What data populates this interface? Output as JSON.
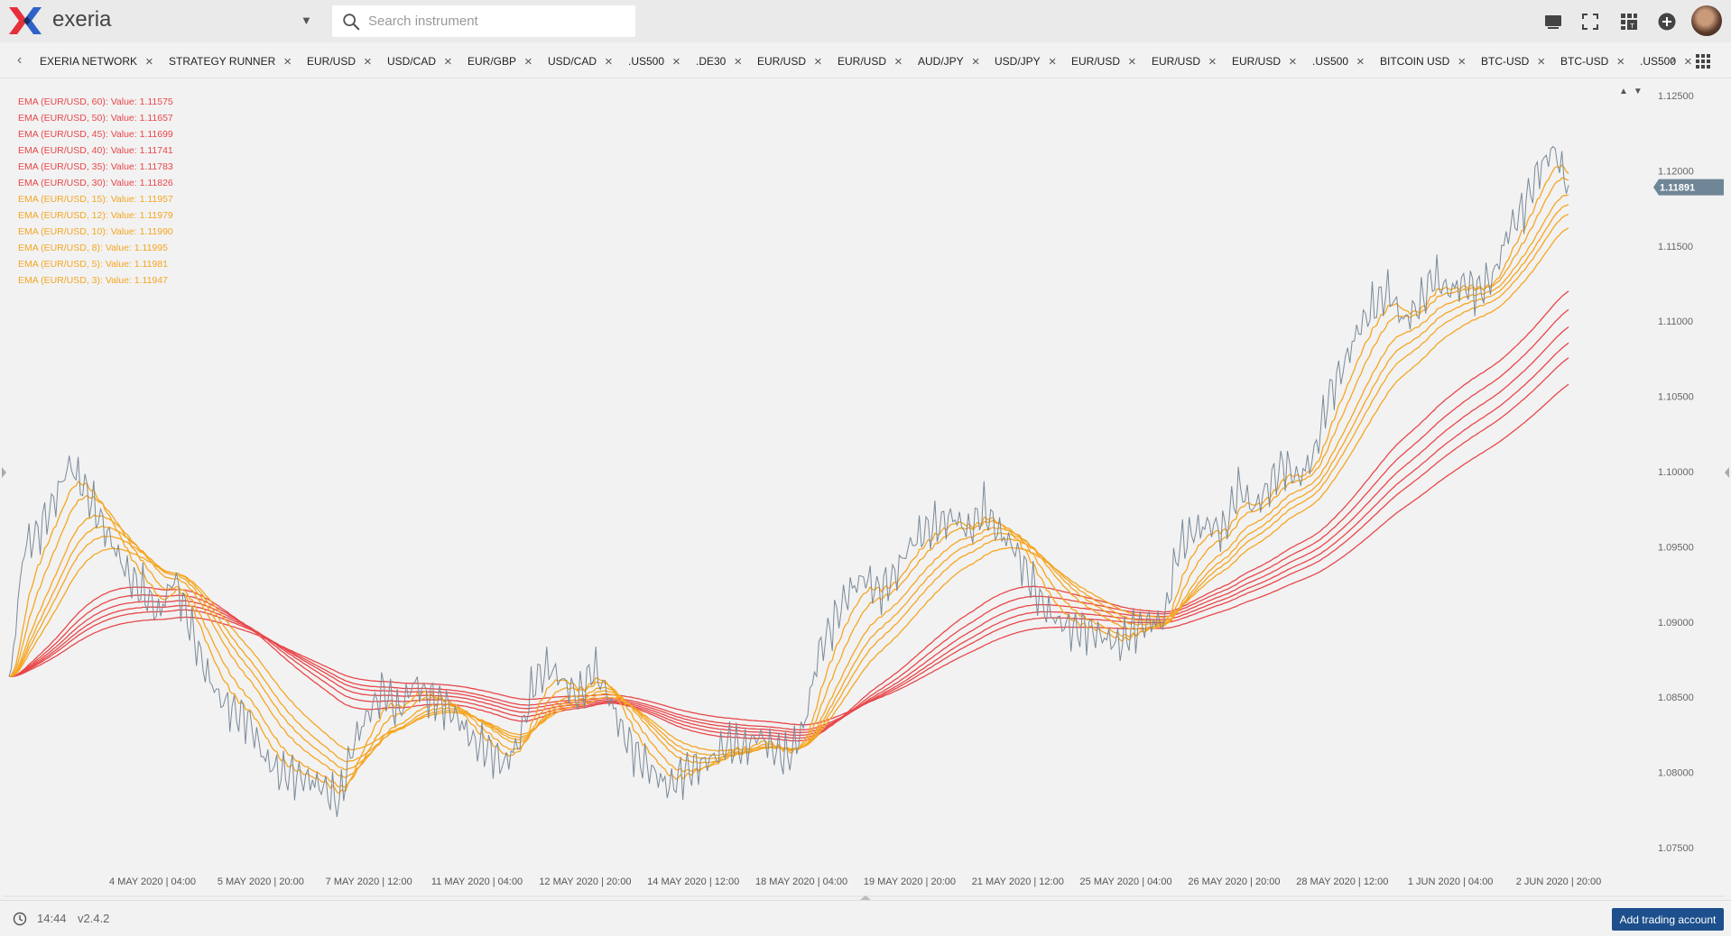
{
  "app": {
    "name": "exeria",
    "logo_colors": {
      "red": "#e5303a",
      "blue": "#2f62c8",
      "dark": "#1a2f66"
    }
  },
  "search": {
    "placeholder": "Search instrument",
    "value": ""
  },
  "header_icons": [
    "monitor-icon",
    "fullscreen-icon",
    "layout-icon",
    "add-circle-icon"
  ],
  "tabs": [
    {
      "label": "EXERIA NETWORK"
    },
    {
      "label": "STRATEGY RUNNER"
    },
    {
      "label": "EUR/USD"
    },
    {
      "label": "USD/CAD"
    },
    {
      "label": "EUR/GBP"
    },
    {
      "label": "USD/CAD"
    },
    {
      "label": ".US500"
    },
    {
      "label": ".DE30"
    },
    {
      "label": "EUR/USD"
    },
    {
      "label": "EUR/USD"
    },
    {
      "label": "AUD/JPY"
    },
    {
      "label": "USD/JPY"
    },
    {
      "label": "EUR/USD"
    },
    {
      "label": "EUR/USD"
    },
    {
      "label": "EUR/USD"
    },
    {
      "label": ".US500"
    },
    {
      "label": "BITCOIN USD"
    },
    {
      "label": "BTC-USD"
    },
    {
      "label": "BTC-USD"
    },
    {
      "label": ".US500"
    }
  ],
  "chart_data": {
    "type": "line",
    "legend_placement": "top-left",
    "grid": false,
    "ylim": [
      1.075,
      1.125
    ],
    "y_ticks": [
      "1.12500",
      "1.12000",
      "1.11500",
      "1.11000",
      "1.10500",
      "1.10000",
      "1.09500",
      "1.09000",
      "1.08500",
      "1.08000",
      "1.07500"
    ],
    "x_ticks": [
      "4 MAY 2020 | 04:00",
      "5 MAY 2020 | 20:00",
      "7 MAY 2020 | 12:00",
      "11 MAY 2020 | 04:00",
      "12 MAY 2020 | 20:00",
      "14 MAY 2020 | 12:00",
      "18 MAY 2020 | 04:00",
      "19 MAY 2020 | 20:00",
      "21 MAY 2020 | 12:00",
      "25 MAY 2020 | 04:00",
      "26 MAY 2020 | 20:00",
      "28 MAY 2020 | 12:00",
      "1 JUN 2020 | 04:00",
      "2 JUN 2020 | 20:00"
    ],
    "current_price": "1.11891",
    "price_series": {
      "color": "#7a8a99",
      "values": [
        1.0855,
        1.095,
        1.096,
        1.098,
        1.1005,
        1.099,
        1.097,
        1.095,
        1.093,
        1.092,
        1.0905,
        1.093,
        1.09,
        1.087,
        1.085,
        1.084,
        1.0835,
        1.081,
        1.08,
        1.0798,
        1.0795,
        1.079,
        1.078,
        1.082,
        1.084,
        1.0855,
        1.084,
        1.086,
        1.085,
        1.0845,
        1.0835,
        1.082,
        1.0815,
        1.0805,
        1.082,
        1.086,
        1.087,
        1.086,
        1.085,
        1.087,
        1.085,
        1.0825,
        1.081,
        1.08,
        1.079,
        1.08,
        1.0805,
        1.081,
        1.082,
        1.0815,
        1.0825,
        1.0815,
        1.081,
        1.083,
        1.088,
        1.09,
        1.092,
        1.093,
        1.092,
        1.093,
        1.095,
        1.096,
        1.0965,
        1.097,
        1.096,
        1.0975,
        1.096,
        1.095,
        1.093,
        1.091,
        1.09,
        1.0895,
        1.0895,
        1.089,
        1.0885,
        1.0895,
        1.09,
        1.09,
        1.095,
        1.096,
        1.0965,
        1.096,
        1.099,
        1.0975,
        1.099,
        1.1005,
        1.0995,
        1.101,
        1.105,
        1.107,
        1.1095,
        1.111,
        1.112,
        1.11,
        1.111,
        1.113,
        1.112,
        1.1125,
        1.112,
        1.113,
        1.116,
        1.1175,
        1.12,
        1.1215,
        1.1189
      ]
    },
    "series": [
      {
        "name": "EMA (EUR/USD, 60): Value: 1.11575",
        "color": "#e8474a",
        "period": 60
      },
      {
        "name": "EMA (EUR/USD, 50): Value: 1.11657",
        "color": "#e8474a",
        "period": 50
      },
      {
        "name": "EMA (EUR/USD, 45): Value: 1.11699",
        "color": "#e8474a",
        "period": 45
      },
      {
        "name": "EMA (EUR/USD, 40): Value: 1.11741",
        "color": "#e8474a",
        "period": 40
      },
      {
        "name": "EMA (EUR/USD, 35): Value: 1.11783",
        "color": "#e8474a",
        "period": 35
      },
      {
        "name": "EMA (EUR/USD, 30): Value: 1.11826",
        "color": "#e8474a",
        "period": 30
      },
      {
        "name": "EMA (EUR/USD, 15): Value: 1.11957",
        "color": "#f5a623",
        "period": 15
      },
      {
        "name": "EMA (EUR/USD, 12): Value: 1.11979",
        "color": "#f5a623",
        "period": 12
      },
      {
        "name": "EMA (EUR/USD, 10): Value: 1.11990",
        "color": "#f5a623",
        "period": 10
      },
      {
        "name": "EMA (EUR/USD, 8): Value: 1.11995",
        "color": "#f5a623",
        "period": 8
      },
      {
        "name": "EMA (EUR/USD, 5): Value: 1.11981",
        "color": "#f5a623",
        "period": 5
      },
      {
        "name": "EMA (EUR/USD, 3): Value: 1.11947",
        "color": "#f5a623",
        "period": 3
      }
    ]
  },
  "footer": {
    "time": "14:44",
    "version": "v2.4.2",
    "add_account_label": "Add trading account"
  }
}
